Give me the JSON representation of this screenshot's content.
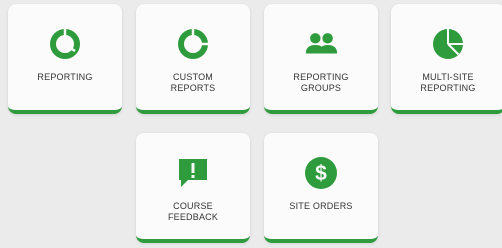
{
  "theme": {
    "accent": "#2e9b3c",
    "tile_bg": "#fbfbfc",
    "page_bg": "#ebebeb"
  },
  "tiles": [
    {
      "label": "REPORTING",
      "icon": "donut-chart-icon"
    },
    {
      "label": "CUSTOM\nREPORTS",
      "icon": "ring-chart-icon"
    },
    {
      "label": "REPORTING\nGROUPS",
      "icon": "users-group-icon"
    },
    {
      "label": "MULTI-SITE\nREPORTING",
      "icon": "pie-chart-icon"
    },
    {
      "label": "COURSE\nFEEDBACK",
      "icon": "feedback-alert-icon"
    },
    {
      "label": "SITE ORDERS",
      "icon": "dollar-circle-icon"
    }
  ]
}
